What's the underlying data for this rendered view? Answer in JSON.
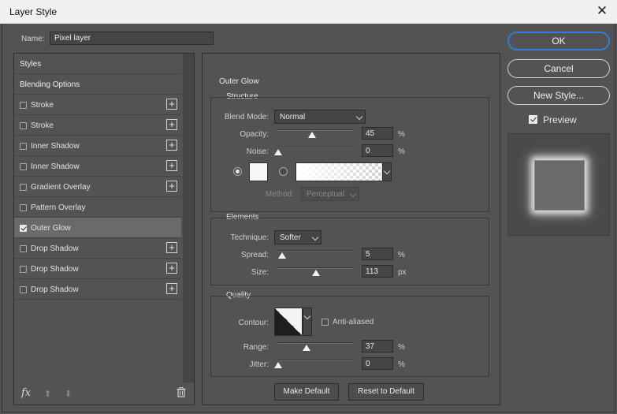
{
  "window": {
    "title": "Layer Style",
    "close_symbol": "✕"
  },
  "name_field": {
    "label": "Name:",
    "value": "Pixel layer"
  },
  "left_panel": {
    "styles_label": "Styles",
    "blending_label": "Blending Options",
    "items": [
      {
        "label": "Stroke",
        "checked": false,
        "has_plus": true
      },
      {
        "label": "Stroke",
        "checked": false,
        "has_plus": true
      },
      {
        "label": "Inner Shadow",
        "checked": false,
        "has_plus": true
      },
      {
        "label": "Inner Shadow",
        "checked": false,
        "has_plus": true
      },
      {
        "label": "Gradient Overlay",
        "checked": false,
        "has_plus": true
      },
      {
        "label": "Pattern Overlay",
        "checked": false,
        "has_plus": false
      },
      {
        "label": "Outer Glow",
        "checked": true,
        "has_plus": false
      },
      {
        "label": "Drop Shadow",
        "checked": false,
        "has_plus": true
      },
      {
        "label": "Drop Shadow",
        "checked": false,
        "has_plus": true
      },
      {
        "label": "Drop Shadow",
        "checked": false,
        "has_plus": true
      }
    ],
    "plus_symbol": "+",
    "fx_label": "fx",
    "up_symbol": "⬆",
    "down_symbol": "⬇"
  },
  "outer_glow": {
    "title": "Outer Glow",
    "structure": {
      "title": "Structure",
      "blend_mode_label": "Blend Mode:",
      "blend_mode_value": "Normal",
      "opacity_label": "Opacity:",
      "opacity_value": "45",
      "opacity_fraction": 0.45,
      "noise_label": "Noise:",
      "noise_value": "0",
      "noise_fraction": 0.0,
      "percent": "%",
      "method_label": "Method:",
      "method_value": "Perceptual"
    },
    "elements": {
      "title": "Elements",
      "technique_label": "Technique:",
      "technique_value": "Softer",
      "spread_label": "Spread:",
      "spread_value": "5",
      "spread_fraction": 0.05,
      "size_label": "Size:",
      "size_value": "113",
      "size_fraction": 0.5,
      "percent": "%",
      "px": "px"
    },
    "quality": {
      "title": "Quality",
      "contour_label": "Contour:",
      "anti_aliased_label": "Anti-aliased",
      "range_label": "Range:",
      "range_value": "37",
      "range_fraction": 0.37,
      "jitter_label": "Jitter:",
      "jitter_value": "0",
      "jitter_fraction": 0.0,
      "percent": "%"
    },
    "make_default_label": "Make Default",
    "reset_default_label": "Reset to Default"
  },
  "right_panel": {
    "ok_label": "OK",
    "cancel_label": "Cancel",
    "new_style_label": "New Style...",
    "preview_label": "Preview"
  }
}
